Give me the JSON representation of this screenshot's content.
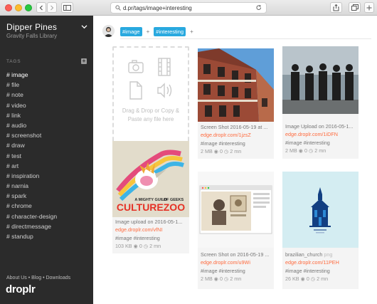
{
  "browser": {
    "url": "d.pr/tags/image+interesting"
  },
  "sidebar": {
    "title": "Dipper Pines",
    "subtitle": "Gravity Falls Library",
    "tags_heading": "TAGS",
    "tags_add": "+",
    "tags": [
      {
        "label": "# image",
        "active": true
      },
      {
        "label": "# file"
      },
      {
        "label": "# note"
      },
      {
        "label": "# video"
      },
      {
        "label": "# link"
      },
      {
        "label": "# audio"
      },
      {
        "label": "# screenshot"
      },
      {
        "label": "# draw"
      },
      {
        "label": "# test"
      },
      {
        "label": "# art"
      },
      {
        "label": "# inspiration"
      },
      {
        "label": "# narnia"
      },
      {
        "label": "# spark"
      },
      {
        "label": "# chrome"
      },
      {
        "label": "# character-design"
      },
      {
        "label": "# directmessage"
      },
      {
        "label": "# standup"
      }
    ],
    "footer": "About Us  •  Blog  •  Downloads",
    "logo": "droplr"
  },
  "search": {
    "chips": [
      "#image",
      "#interesting"
    ],
    "plus": "+"
  },
  "dropzone": {
    "text_line1": "Drag & Drop or Copy &",
    "text_line2": "Paste any file here"
  },
  "cards": [
    {
      "title": "Screen Shot 2016-05-19 at ...",
      "link": "edge.droplr.com/1jzsZ",
      "tags": "#image   #interesting",
      "stats": "2 MB    ◉ 0    ◷ 2 mn"
    },
    {
      "title": "Image Upload on 2016-05-1...",
      "link": "edge.droplr.com/1iDFN",
      "tags": "#image   #interesting",
      "stats": "2 MB    ◉ 0    ◷ 2 mn"
    },
    {
      "title": "Image upload on 2016-05-1...",
      "link": "edge.droplr.com/vfNI",
      "tags": "#image   #interesting",
      "stats": "103 KB    ◉ 0    ◷ 2 mn"
    },
    {
      "title": "Screen Shot on 2016-05-19 ...",
      "link": "edge.droplr.com/u9Wi",
      "tags": "#image   #interesting",
      "stats": "2 MB    ◉ 0    ◷ 2 mn"
    },
    {
      "title": "brazilian_church",
      "title_ext": "png",
      "link": "edge.droplr.com/11PEH",
      "tags": "#image   #interesting",
      "stats": "26 KB    ◉ 0    ◷ 2 mn"
    }
  ],
  "cover": {
    "line1": "A MIGHTY GUILD",
    "line2": "OF GEEKS",
    "big": "CULTUREZOO"
  },
  "colors": {
    "sidebar_bg": "#2b2b2b",
    "accent_chip": "#29a9df",
    "link": "#ff6a3d"
  }
}
